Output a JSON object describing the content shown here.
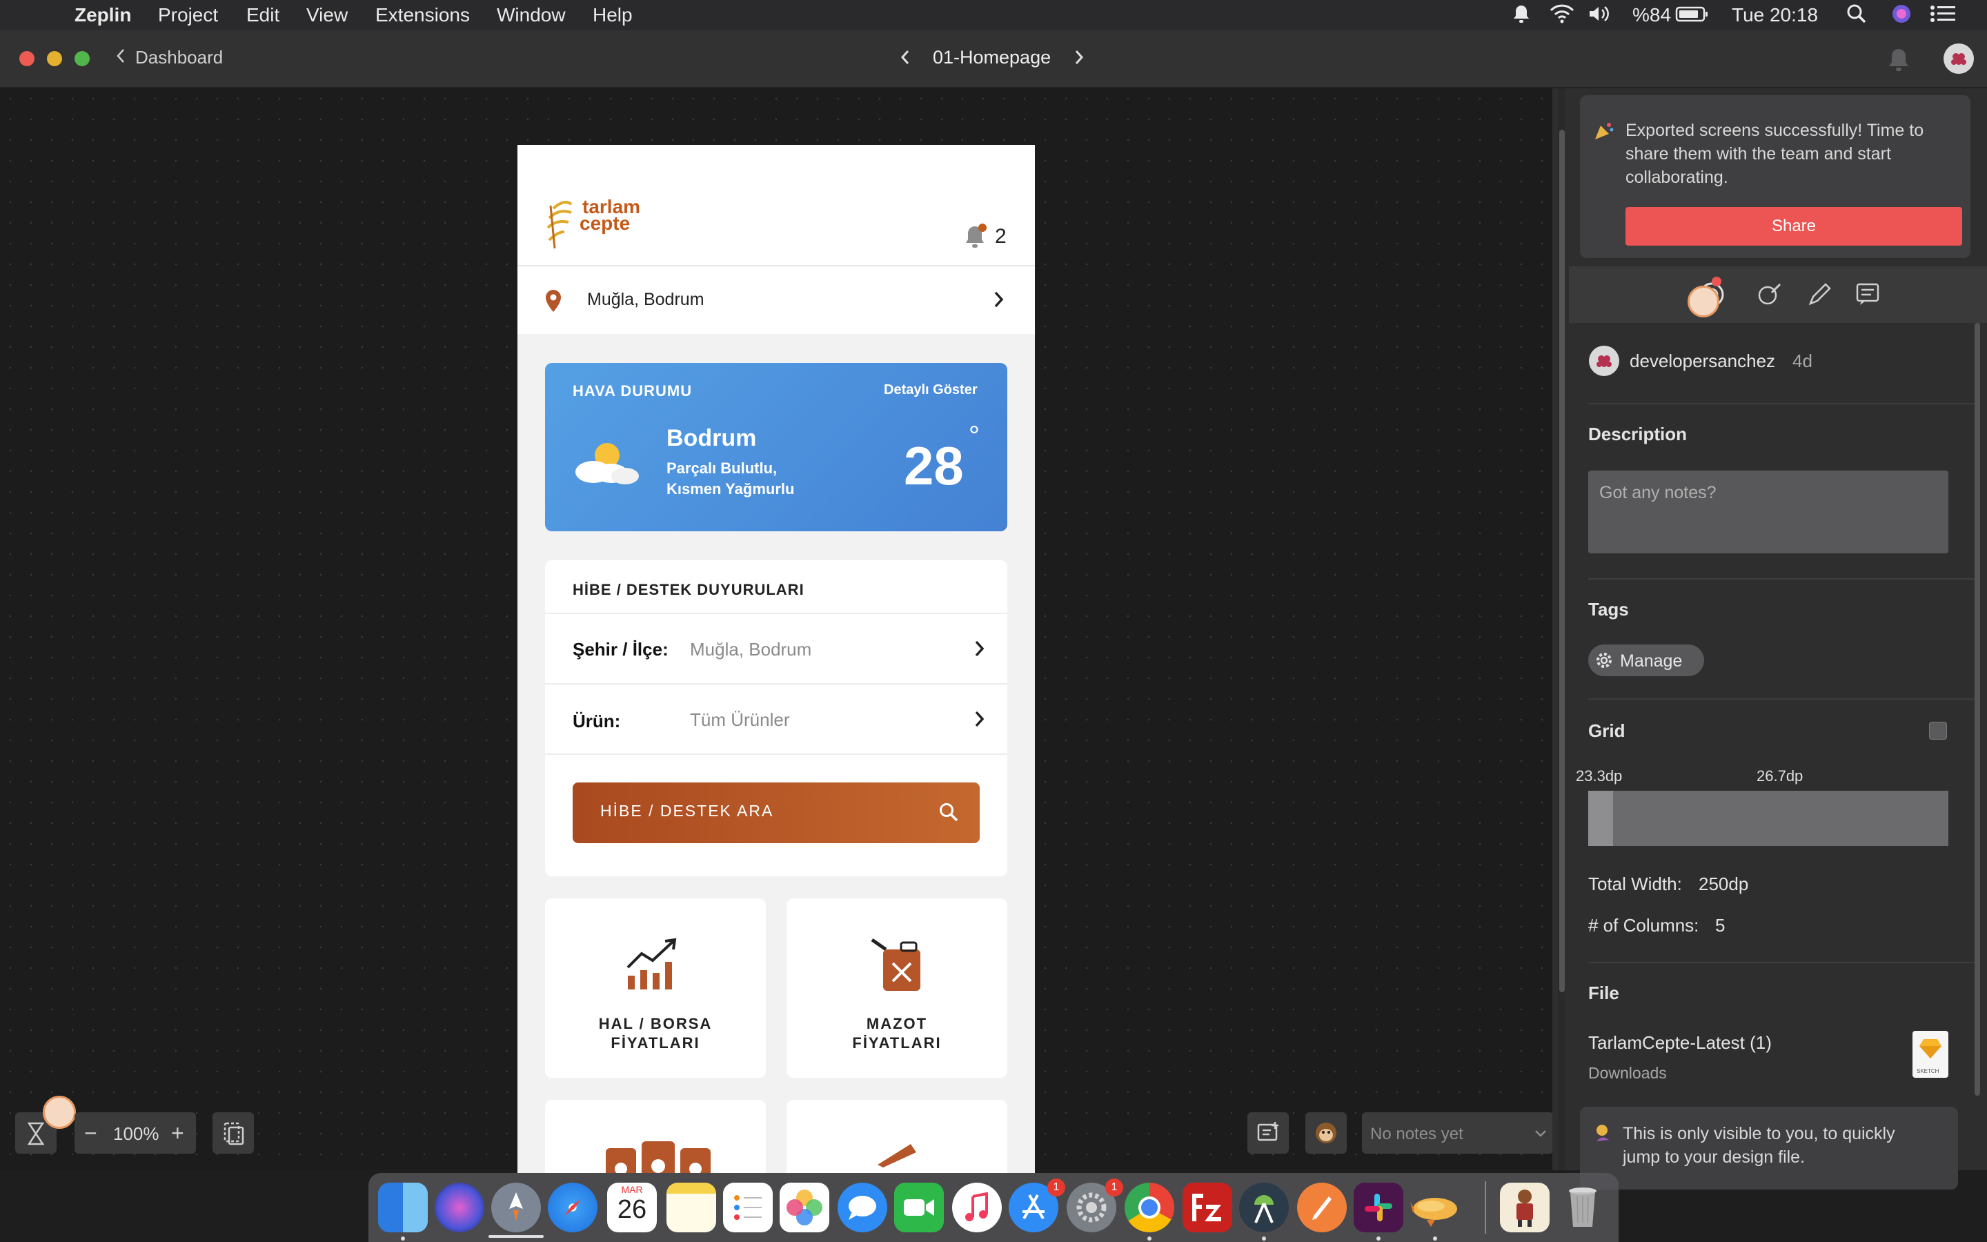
{
  "menubar": {
    "app_name": "Zeplin",
    "menus": [
      "Project",
      "Edit",
      "View",
      "Extensions",
      "Window",
      "Help"
    ],
    "battery": "%84",
    "clock": "Tue 20:18"
  },
  "titlebar": {
    "back_label": "Dashboard",
    "screen_name": "01-Homepage"
  },
  "app": {
    "logo_line1": "tarlam",
    "logo_line2": "cepte",
    "notification_count": "2",
    "location": "Muğla, Bodrum",
    "weather": {
      "header": "HAVA DURUMU",
      "detail_link": "Detaylı Göster",
      "city": "Bodrum",
      "condition_line1": "Parçalı Bulutlu,",
      "condition_line2": "Kısmen Yağmurlu",
      "temperature": "28",
      "degree": "°"
    },
    "grants": {
      "title": "HİBE / DESTEK DUYURULARI",
      "city_label": "Şehir / İlçe:",
      "city_value": "Muğla, Bodrum",
      "product_label": "Ürün:",
      "product_value": "Tüm Ürünler",
      "search_button": "HİBE / DESTEK ARA"
    },
    "tiles": [
      {
        "line1": "HAL / BORSA",
        "line2": "FİYATLARI"
      },
      {
        "line1": "MAZOT",
        "line2": "FİYATLARI"
      }
    ]
  },
  "canvas_toolbar": {
    "zoom": "100%",
    "notes_placeholder": "No notes yet"
  },
  "panel": {
    "toast_text_line1": "Exported screens successfully! Time to",
    "toast_text_line2": "share them with the team and start",
    "toast_text_line3": "collaborating.",
    "share_button": "Share",
    "author": "developersanchez",
    "age": "4d",
    "description_title": "Description",
    "description_placeholder": "Got any notes?",
    "tags_title": "Tags",
    "manage_button": "Manage",
    "grid_title": "Grid",
    "grid_left_value": "23.3dp",
    "grid_right_value": "26.7dp",
    "total_width_label": "Total Width:",
    "total_width_value": "250dp",
    "columns_label": "# of Columns:",
    "columns_value": "5",
    "file_title": "File",
    "file_name": "TarlamCepte-Latest (1)",
    "file_location": "Downloads",
    "sketch_label": "SKETCH",
    "private_note_line1": "This is only visible to you, to quickly",
    "private_note_line2": "jump to your design file."
  },
  "dock": {
    "calendar_month": "MAR",
    "calendar_day": "26",
    "appstore_badge": "1",
    "prefs_badge": "1"
  },
  "colors": {
    "accent_red": "#ec5553",
    "weather_blue": "#4a8fdd",
    "brand_orange": "#b5552a"
  }
}
